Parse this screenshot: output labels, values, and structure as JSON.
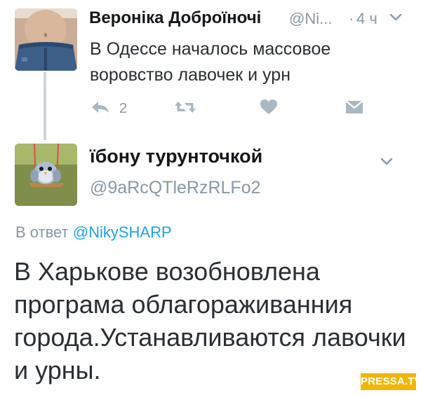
{
  "original_tweet": {
    "author_name": "Вероніка Доброїночі",
    "handle": "@Ni...",
    "separator": "·",
    "time": "4 ч",
    "text": "В Одессе началось массовое воровство лавочек и урн",
    "reply_count": "2",
    "icons": {
      "reply": "reply-icon",
      "retweet": "retweet-icon",
      "like": "heart-icon",
      "dm": "direct-message-icon",
      "menu": "chevron-down-icon"
    }
  },
  "reply_tweet": {
    "author_name": "їбону турунточкой",
    "handle": "@9aRcQTleRzRLFo2",
    "reply_prefix": "В ответ",
    "reply_mention": "@NikySHARP",
    "text": "В Харькове возобновлена програма облагораживанния города.Устанавливаются лавочки и урны."
  },
  "watermark": {
    "text": "PRESSA.TV",
    "color": "#f2b705"
  },
  "colors": {
    "secondary_text": "#8899a6",
    "link": "#1da1f2",
    "thread_line": "#ccd6dd"
  }
}
